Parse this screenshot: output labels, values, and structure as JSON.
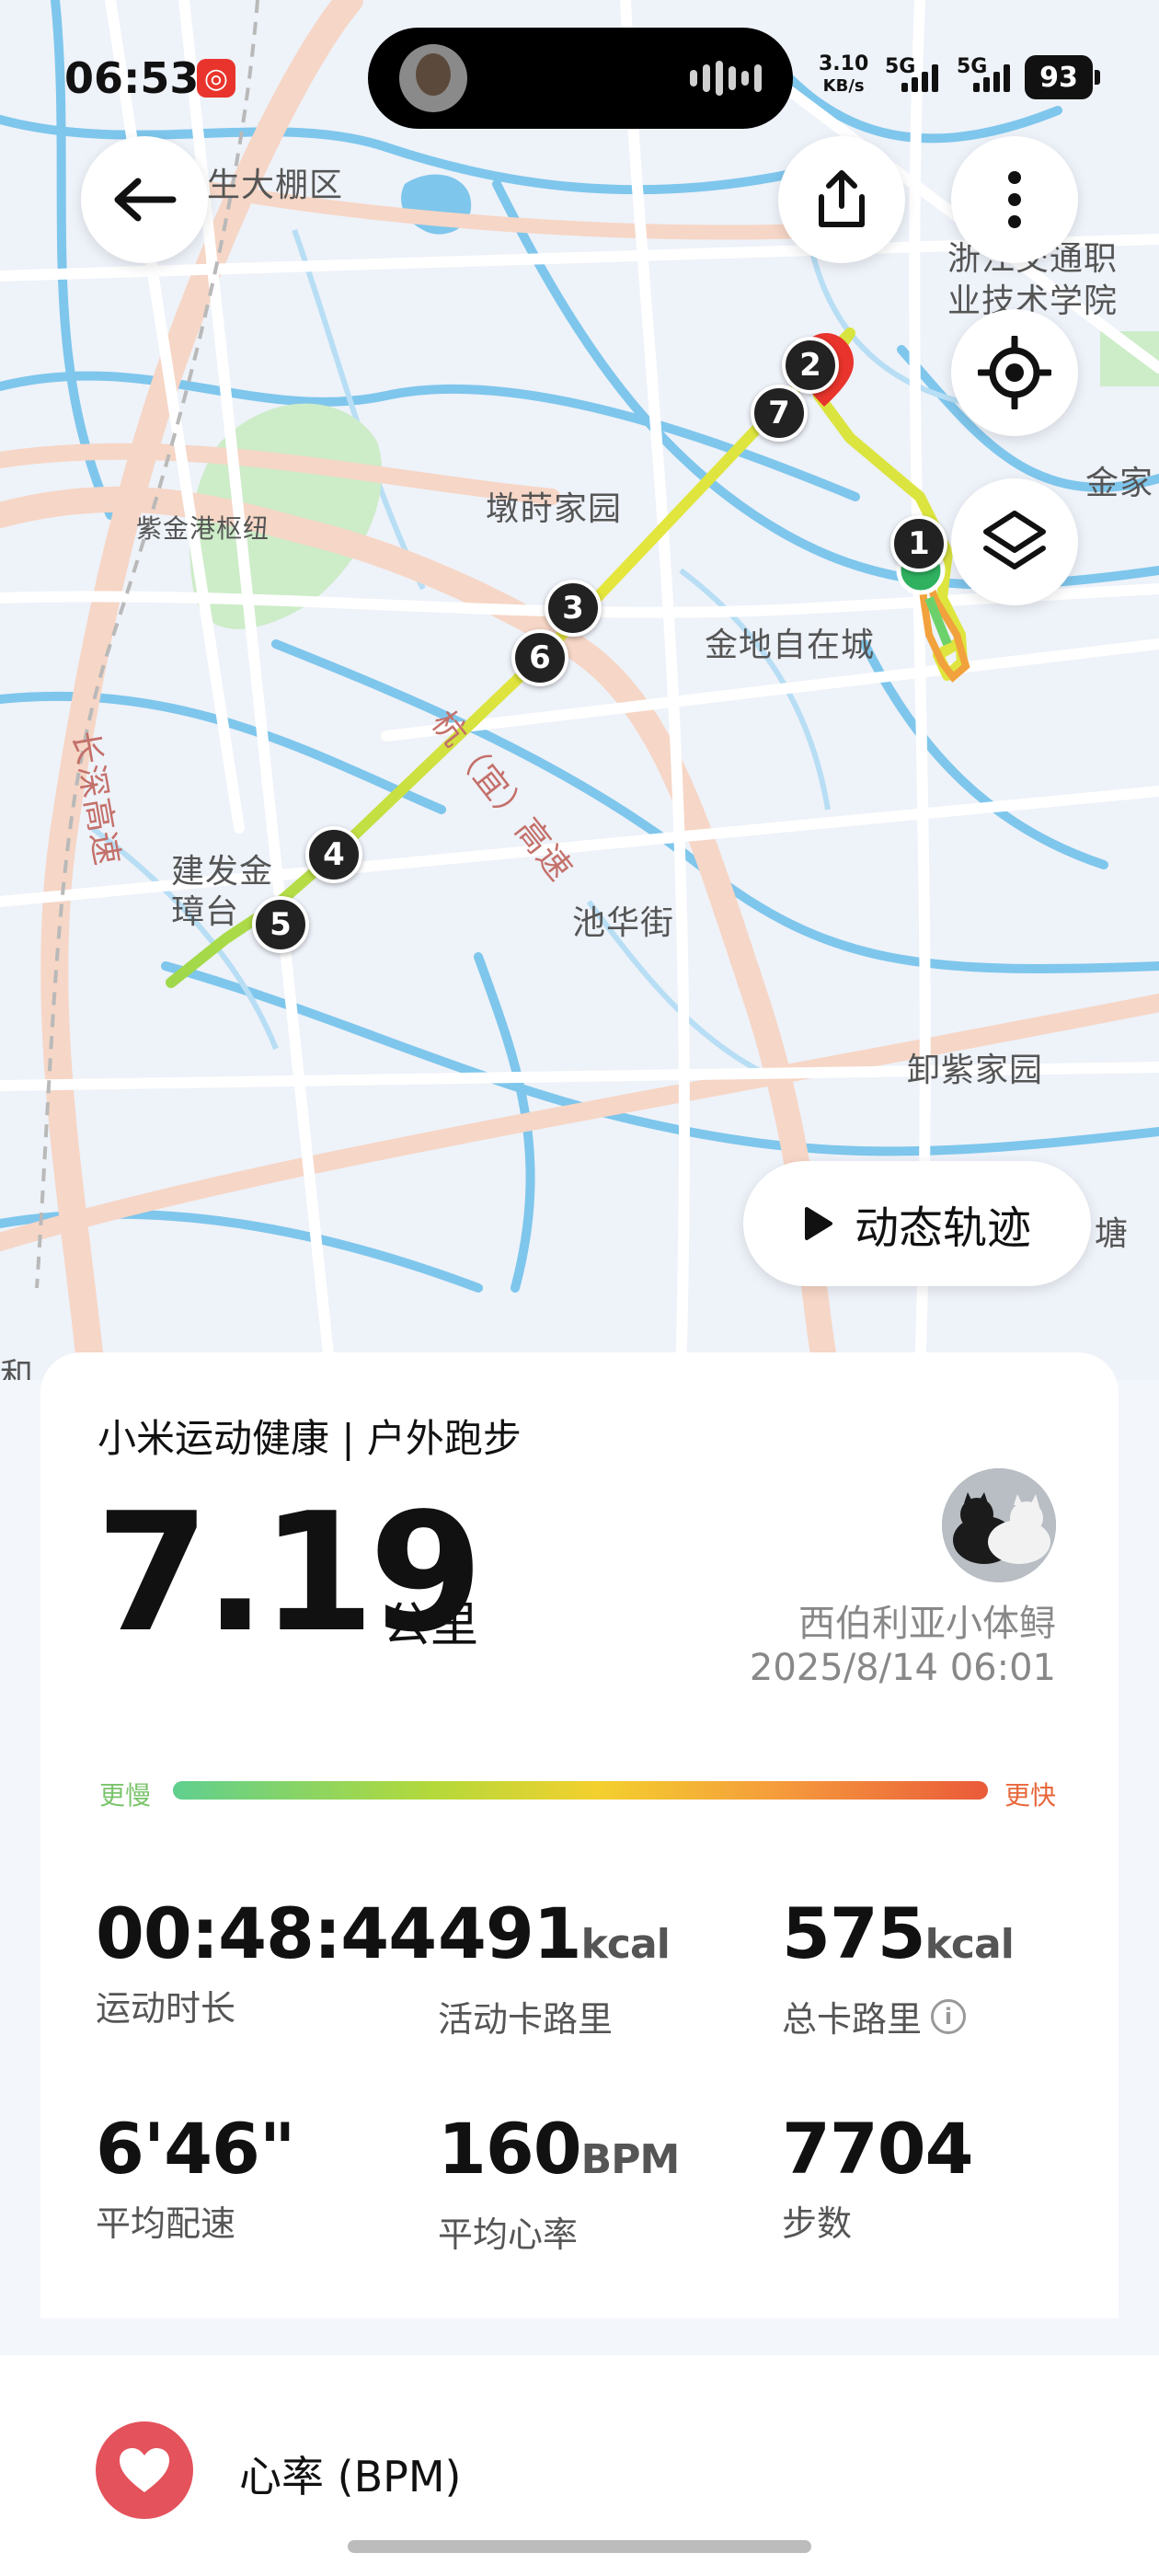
{
  "status_bar": {
    "time": "06:53",
    "net_speed_value": "3.10",
    "net_speed_unit": "KB/s",
    "sim1": "5G",
    "sim2": "5G",
    "battery": "93"
  },
  "map": {
    "labels": {
      "shengdapeng": "生大棚区",
      "college_a": "浙江交通职",
      "college_b": "业技术学院",
      "jinjia": "金家",
      "zijingang": "紫金港枢纽",
      "dunpu": "墩莳家园",
      "jindi": "金地自在城",
      "hangyi": "杭（宜）高速",
      "changshen": "长深高速",
      "jianfa_a": "建发金",
      "jianfa_b": "璋台",
      "chihua": "池华街",
      "xiezi": "卸紫家园",
      "he": "和",
      "tang": "塘"
    },
    "markers": [
      "1",
      "2",
      "3",
      "4",
      "5",
      "6",
      "7"
    ]
  },
  "buttons": {
    "back": "back",
    "share": "share",
    "more": "more",
    "locate": "locate",
    "layers": "layers",
    "replay": "动态轨迹"
  },
  "card": {
    "header": "小米运动健康 | 户外跑步",
    "distance": "7.19",
    "distance_unit": "公里",
    "user_name": "西伯利亚小体鲟",
    "datetime": "2025/8/14 06:01",
    "pace_slow": "更慢",
    "pace_fast": "更快",
    "stats": [
      {
        "value": "00:48:44",
        "unit": "",
        "label": "运动时长"
      },
      {
        "value": "491",
        "unit": "kcal",
        "label": "活动卡路里"
      },
      {
        "value": "575",
        "unit": "kcal",
        "label": "总卡路里"
      },
      {
        "value": "6'46\"",
        "unit": "",
        "label": "平均配速"
      },
      {
        "value": "160",
        "unit": "BPM",
        "label": "平均心率"
      },
      {
        "value": "7704",
        "unit": "",
        "label": "步数"
      }
    ]
  },
  "heart_section": {
    "label": "心率 (BPM)"
  },
  "colors": {
    "route_slow": "#5fcf8f",
    "route_mid": "#f3d02e",
    "route_fast": "#ea5a3a",
    "pin": "#e8342c",
    "heart": "#e4525c"
  }
}
